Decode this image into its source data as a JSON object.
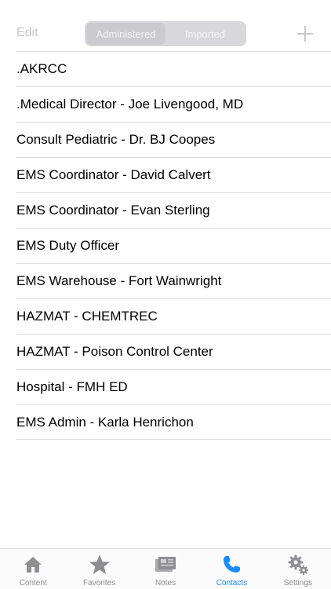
{
  "navbar": {
    "edit_label": "Edit",
    "segments": [
      "Administered",
      "Imported"
    ],
    "selected_segment": "Administered",
    "add_icon": "plus-icon"
  },
  "contacts": [
    ".AKRCC",
    ".Medical Director - Joe Livengood, MD",
    "Consult Pediatric - Dr. BJ Coopes",
    "EMS Coordinator - David Calvert",
    "EMS Coordinator - Evan Sterling",
    "EMS Duty Officer",
    "EMS Warehouse - Fort Wainwright",
    "HAZMAT - CHEMTREC",
    "HAZMAT - Poison Control Center",
    "Hospital - FMH ED",
    "EMS Admin - Karla Henrichon"
  ],
  "tabbar": {
    "tabs": [
      {
        "label": "Content",
        "icon": "house-icon"
      },
      {
        "label": "Favorites",
        "icon": "star-icon"
      },
      {
        "label": "Notes",
        "icon": "notes-icon"
      },
      {
        "label": "Contacts",
        "icon": "phone-icon"
      },
      {
        "label": "Settings",
        "icon": "gear-icon"
      }
    ],
    "active": "Contacts"
  },
  "colors": {
    "accent": "#1a8cff",
    "inactive": "#8e8e93",
    "separator": "#dcdcdf"
  }
}
